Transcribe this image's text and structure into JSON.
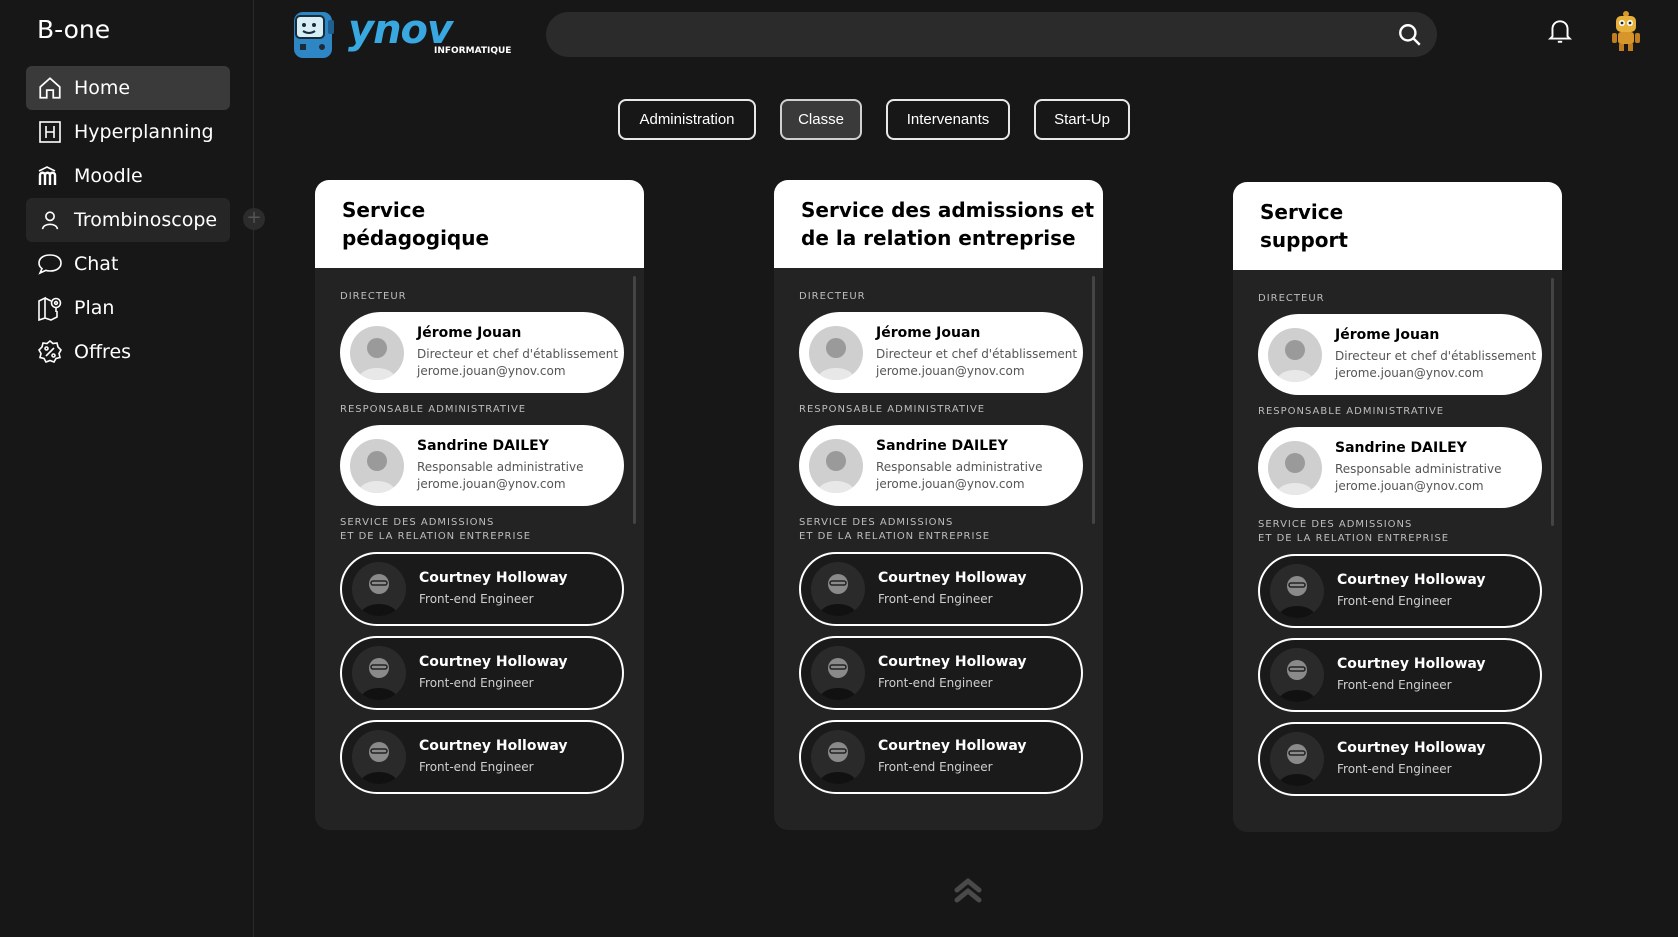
{
  "app": {
    "brand": "B-one"
  },
  "sidebar": {
    "items": [
      {
        "label": "Home",
        "icon": "home-icon"
      },
      {
        "label": "Hyperplanning",
        "icon": "hyperplanning-icon"
      },
      {
        "label": "Moodle",
        "icon": "moodle-icon"
      },
      {
        "label": "Trombinoscope",
        "icon": "user-icon"
      },
      {
        "label": "Chat",
        "icon": "chat-icon"
      },
      {
        "label": "Plan",
        "icon": "map-icon"
      },
      {
        "label": "Offres",
        "icon": "offers-icon"
      }
    ],
    "add": "+"
  },
  "logo": {
    "name": "ynov",
    "sub": "INFORMATIQUE"
  },
  "search": {
    "placeholder": ""
  },
  "filters": [
    "Administration",
    "Classe",
    "Intervenants",
    "Start-Up"
  ],
  "services": [
    {
      "title": "Service\npédagogique",
      "director_label": "DIRECTEUR",
      "director": {
        "name": "Jérome Jouan",
        "role": "Directeur et chef d'établissement",
        "email": "jerome.jouan@ynov.com"
      },
      "admin_label": "RESPONSABLE ADMINISTRATIVE",
      "admin": {
        "name": "Sandrine DAILEY",
        "role": "Responsable administrative",
        "email": "jerome.jouan@ynov.com"
      },
      "team_label": "SERVICE DES ADMISSIONS\nET DE LA RELATION ENTREPRISE",
      "team": [
        {
          "name": "Courtney Holloway",
          "role": "Front-end Engineer"
        },
        {
          "name": "Courtney Holloway",
          "role": "Front-end Engineer"
        },
        {
          "name": "Courtney Holloway",
          "role": "Front-end Engineer"
        }
      ]
    },
    {
      "title": "Service des admissions et\nde la relation entreprise",
      "director_label": "DIRECTEUR",
      "director": {
        "name": "Jérome Jouan",
        "role": "Directeur et chef d'établissement",
        "email": "jerome.jouan@ynov.com"
      },
      "admin_label": "RESPONSABLE ADMINISTRATIVE",
      "admin": {
        "name": "Sandrine DAILEY",
        "role": "Responsable administrative",
        "email": "jerome.jouan@ynov.com"
      },
      "team_label": "SERVICE DES ADMISSIONS\nET DE LA RELATION ENTREPRISE",
      "team": [
        {
          "name": "Courtney Holloway",
          "role": "Front-end Engineer"
        },
        {
          "name": "Courtney Holloway",
          "role": "Front-end Engineer"
        },
        {
          "name": "Courtney Holloway",
          "role": "Front-end Engineer"
        }
      ]
    },
    {
      "title": "Service\nsupport",
      "director_label": "DIRECTEUR",
      "director": {
        "name": "Jérome Jouan",
        "role": "Directeur et chef d'établissement",
        "email": "jerome.jouan@ynov.com"
      },
      "admin_label": "RESPONSABLE ADMINISTRATIVE",
      "admin": {
        "name": "Sandrine DAILEY",
        "role": "Responsable administrative",
        "email": "jerome.jouan@ynov.com"
      },
      "team_label": "SERVICE DES ADMISSIONS\nET DE LA RELATION ENTREPRISE",
      "team": [
        {
          "name": "Courtney Holloway",
          "role": "Front-end Engineer"
        },
        {
          "name": "Courtney Holloway",
          "role": "Front-end Engineer"
        },
        {
          "name": "Courtney Holloway",
          "role": "Front-end Engineer"
        }
      ]
    }
  ],
  "colors": {
    "background": "#171717",
    "card": "#232323",
    "accent": "#3aa8e0",
    "active_nav": "#3a3a3a"
  }
}
